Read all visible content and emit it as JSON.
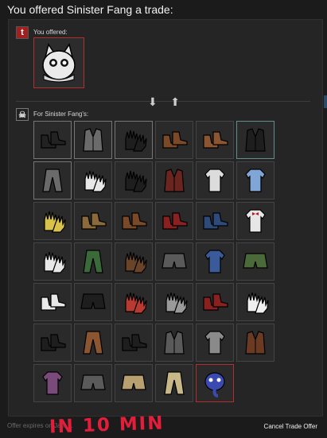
{
  "page": {
    "title": "You offered Sinister Fang a trade:"
  },
  "you_offered": {
    "label": "You offered:",
    "avatar_letter": "t",
    "item": {
      "icon": "cat-hat-icon",
      "rarity_color": "#b03030"
    }
  },
  "exchange_icon": "swap-arrows-icon",
  "for_partner": {
    "label": "For Sinister Fang's:",
    "items": [
      {
        "icon": "black-shoes-icon",
        "rarity": "grey",
        "color": "#222222"
      },
      {
        "icon": "grey-vest-icon",
        "rarity": "grey",
        "color": "#6b6b6b"
      },
      {
        "icon": "black-gloves-icon",
        "rarity": "grey",
        "color": "#1e1e1e"
      },
      {
        "icon": "brown-boots-icon",
        "rarity": "plain",
        "color": "#7a4a28"
      },
      {
        "icon": "brown-boots-icon",
        "rarity": "plain",
        "color": "#8a5530"
      },
      {
        "icon": "black-jacket-icon",
        "rarity": "teal",
        "color": "#1e1e1e"
      },
      {
        "icon": "grey-pants-icon",
        "rarity": "grey",
        "color": "#6a6a6a"
      },
      {
        "icon": "white-gloves-icon",
        "rarity": "plain",
        "color": "#e8e8e8"
      },
      {
        "icon": "black-gloves-icon",
        "rarity": "plain",
        "color": "#1e1e1e"
      },
      {
        "icon": "red-vest-icon",
        "rarity": "plain",
        "color": "#6a2520"
      },
      {
        "icon": "white-shirt-icon",
        "rarity": "plain",
        "color": "#dcdcdc"
      },
      {
        "icon": "blue-shirt-icon",
        "rarity": "plain",
        "color": "#7fa6d6"
      },
      {
        "icon": "yellow-gloves-icon",
        "rarity": "plain",
        "color": "#d8c24a"
      },
      {
        "icon": "tan-boots-icon",
        "rarity": "plain",
        "color": "#8a6a3a"
      },
      {
        "icon": "brown-shoes-icon",
        "rarity": "plain",
        "color": "#7a4a28"
      },
      {
        "icon": "red-shoes-icon",
        "rarity": "plain",
        "color": "#8a2020"
      },
      {
        "icon": "blue-shoes-icon",
        "rarity": "plain",
        "color": "#2e4a7a"
      },
      {
        "icon": "white-shirt-bowtie-icon",
        "rarity": "plain",
        "color": "#e6e6e6"
      },
      {
        "icon": "white-gloves-icon",
        "rarity": "plain",
        "color": "#e8e8e8"
      },
      {
        "icon": "green-pants-icon",
        "rarity": "plain",
        "color": "#3a6a3a"
      },
      {
        "icon": "brown-gloves-icon",
        "rarity": "plain",
        "color": "#6a4428"
      },
      {
        "icon": "grey-skirt-icon",
        "rarity": "plain",
        "color": "#5a5a5a"
      },
      {
        "icon": "blue-shirt-icon",
        "rarity": "plain",
        "color": "#3a5a9a"
      },
      {
        "icon": "green-shorts-icon",
        "rarity": "plain",
        "color": "#4a6a3a"
      },
      {
        "icon": "white-boots-icon",
        "rarity": "plain",
        "color": "#e8e8e8"
      },
      {
        "icon": "black-skirt-icon",
        "rarity": "plain",
        "color": "#1e1e1e"
      },
      {
        "icon": "red-gloves-icon",
        "rarity": "plain",
        "color": "#b83a30"
      },
      {
        "icon": "grey-gloves-icon",
        "rarity": "plain",
        "color": "#9a9a9a"
      },
      {
        "icon": "red-shoes-icon",
        "rarity": "plain",
        "color": "#8a2020"
      },
      {
        "icon": "white-gloves-icon",
        "rarity": "plain",
        "color": "#f0f0f0"
      },
      {
        "icon": "black-shoes-icon",
        "rarity": "plain",
        "color": "#1e1e1e"
      },
      {
        "icon": "brown-pants-icon",
        "rarity": "plain",
        "color": "#8a5530"
      },
      {
        "icon": "black-boots-icon",
        "rarity": "plain",
        "color": "#1e1e1e"
      },
      {
        "icon": "grey-vest-icon",
        "rarity": "plain",
        "color": "#5a5a5a"
      },
      {
        "icon": "grey-shirt-icon",
        "rarity": "plain",
        "color": "#8a8a8a"
      },
      {
        "icon": "brown-vest-icon",
        "rarity": "plain",
        "color": "#6a3a22"
      },
      {
        "icon": "purple-shirt-icon",
        "rarity": "plain",
        "color": "#7a4a7a"
      },
      {
        "icon": "grey-shorts-icon",
        "rarity": "plain",
        "color": "#5a5a5a"
      },
      {
        "icon": "tan-shorts-icon",
        "rarity": "plain",
        "color": "#b8a070"
      },
      {
        "icon": "tan-pants-icon",
        "rarity": "plain",
        "color": "#c8b888"
      },
      {
        "icon": "blue-elephant-icon",
        "rarity": "red",
        "color": "#3a4ab0"
      }
    ]
  },
  "footer": {
    "expires_text": "Offer expires on Jan, ...",
    "cancel_label": "Cancel Trade Offer",
    "scribble": "IN 10 MIN"
  }
}
